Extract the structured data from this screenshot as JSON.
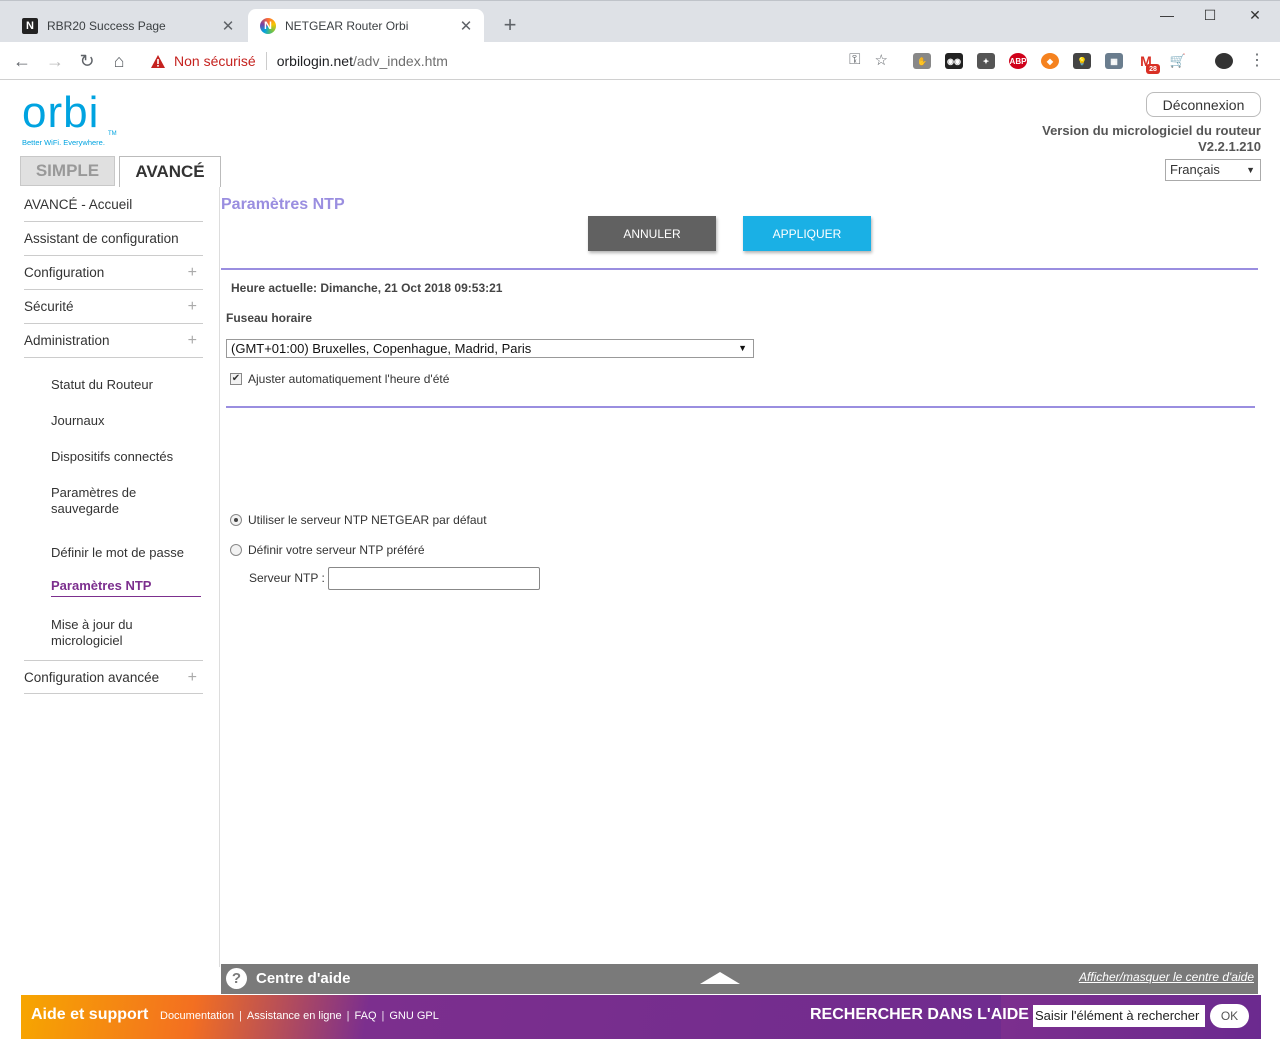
{
  "browser": {
    "tabs": [
      {
        "label": "RBR20 Success Page",
        "favicon": "netgear-n-icon"
      },
      {
        "label": "NETGEAR Router Orbi",
        "favicon": "orbi-icon"
      }
    ],
    "new_tab": "+",
    "window_controls": {
      "minimize": "—",
      "maximize": "☐",
      "close": "✕"
    },
    "security_text": "Non sécurisé",
    "url_host": "orbilogin.net",
    "url_path": "/adv_index.htm",
    "extension_badge": "28",
    "extension_abp": "ABP"
  },
  "header": {
    "logo_word": "orbi",
    "logo_tm": "TM",
    "logo_tagline": "Better WiFi. Everywhere.",
    "logout_label": "Déconnexion",
    "firmware_label": "Version du micrologiciel du routeur",
    "firmware_version": "V2.2.1.210",
    "language": "Français",
    "mode_tabs": {
      "simple": "SIMPLE",
      "advanced": "AVANCÉ"
    }
  },
  "sidebar": {
    "main_items": [
      {
        "label": "AVANCÉ - Accueil",
        "expandable": false
      },
      {
        "label": "Assistant de configuration",
        "expandable": false
      },
      {
        "label": "Configuration",
        "expandable": true
      },
      {
        "label": "Sécurité",
        "expandable": true
      },
      {
        "label": "Administration",
        "expandable": true
      }
    ],
    "sub_items": [
      {
        "label": "Statut du Routeur"
      },
      {
        "label": "Journaux"
      },
      {
        "label": "Dispositifs connectés"
      },
      {
        "label": "Paramètres de sauvegarde"
      },
      {
        "label": "Définir le mot de passe"
      },
      {
        "label": "Paramètres NTP",
        "active": true
      },
      {
        "label": "Mise à jour du micrologiciel"
      }
    ],
    "advanced_config": "Configuration avancée",
    "plus_glyph": "+"
  },
  "main": {
    "title": "Paramètres NTP",
    "cancel_label": "ANNULER",
    "apply_label": "APPLIQUER",
    "current_time": "Heure actuelle: Dimanche, 21 Oct 2018 09:53:21",
    "timezone_label": "Fuseau horaire",
    "timezone_value": "(GMT+01:00) Bruxelles, Copenhague, Madrid, Paris",
    "dst_label": "Ajuster automatiquement l'heure d'été",
    "dst_checked": true,
    "radio_default_label": "Utiliser le serveur NTP NETGEAR par défaut",
    "radio_custom_label": "Définir votre serveur NTP préféré",
    "ntp_server_label": "Serveur NTP :",
    "ntp_server_value": ""
  },
  "help": {
    "title": "Centre d'aide",
    "toggle_label": "Afficher/masquer le centre d'aide"
  },
  "footer": {
    "title": "Aide et support",
    "links": [
      "Documentation",
      "Assistance en ligne",
      "FAQ",
      "GNU GPL"
    ],
    "search_label": "RECHERCHER DANS L'AIDE",
    "search_value": "Saisir l'élément à rechercher",
    "ok_label": "OK"
  },
  "colors": {
    "accent_purple": "#9a8ee0",
    "active_nav": "#7c2f8e",
    "apply_blue": "#1ab0e5",
    "cancel_gray": "#616161",
    "logo_blue": "#00a3e0"
  }
}
